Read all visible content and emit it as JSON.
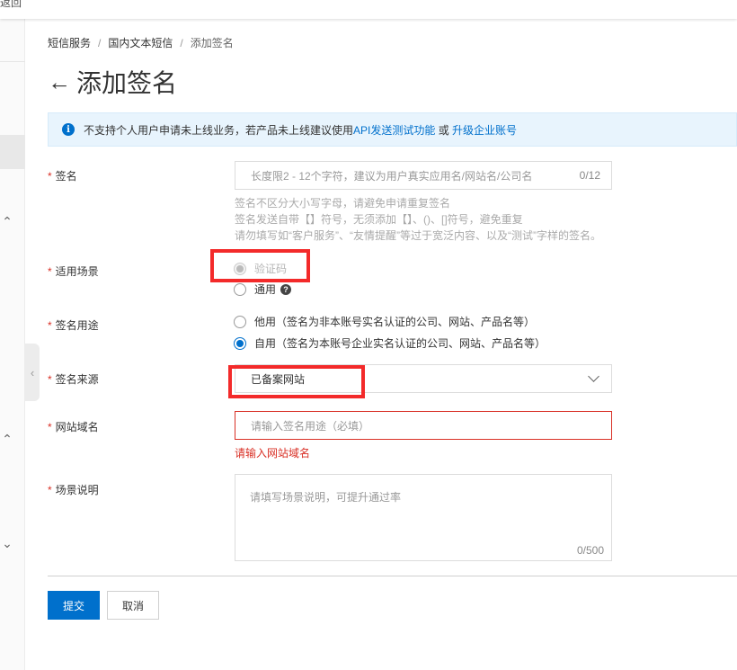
{
  "topbar": {
    "partial_text": "返回"
  },
  "breadcrumb": {
    "items": [
      "短信服务",
      "国内文本短信",
      "添加签名"
    ],
    "separator": "/"
  },
  "page": {
    "back_icon": "←",
    "title": "添加签名"
  },
  "notice": {
    "icon": "i",
    "text_before": "不支持个人用户申请未上线业务，若产品未上线建议使用",
    "link1": "API发送测试功能",
    "text_mid": " 或 ",
    "link2": "升级企业账号"
  },
  "form": {
    "required_mark": "*",
    "signature": {
      "label": "签名",
      "placeholder": "长度限2 - 12个字符，建议为用户真实应用名/网站名/公司名",
      "counter": "0/12",
      "help": [
        "签名不区分大小写字母，请避免申请重复签名",
        "签名发送自带【】符号，无须添加【】、()、[]符号，避免重复",
        "请勿填写如“客户服务”、“友情提醒”等过于宽泛内容、以及“测试”字样的签名。"
      ]
    },
    "scenario": {
      "label": "适用场景",
      "options": [
        "验证码",
        "通用"
      ],
      "selected": "验证码",
      "help_icon": "?"
    },
    "usage": {
      "label": "签名用途",
      "options": [
        "他用（签名为非本账号实名认证的公司、网站、产品名等）",
        "自用（签名为本账号企业实名认证的公司、网站、产品名等）"
      ],
      "selected": "自用"
    },
    "source": {
      "label": "签名来源",
      "value": "已备案网站"
    },
    "domain": {
      "label": "网站域名",
      "placeholder": "请输入签名用途（必填）",
      "error": "请输入网站域名"
    },
    "description": {
      "label": "场景说明",
      "placeholder": "请填写场景说明，可提升通过率",
      "counter": "0/500"
    }
  },
  "actions": {
    "submit": "提交",
    "cancel": "取消"
  },
  "rail": {
    "chevron_up": "⌃",
    "chevron_down": "⌄",
    "collapse_icon": "‹"
  },
  "colors": {
    "primary": "#0070cc",
    "error": "#d93026",
    "annotation": "#f32a2a",
    "notice_bg": "#e8f4fd"
  }
}
